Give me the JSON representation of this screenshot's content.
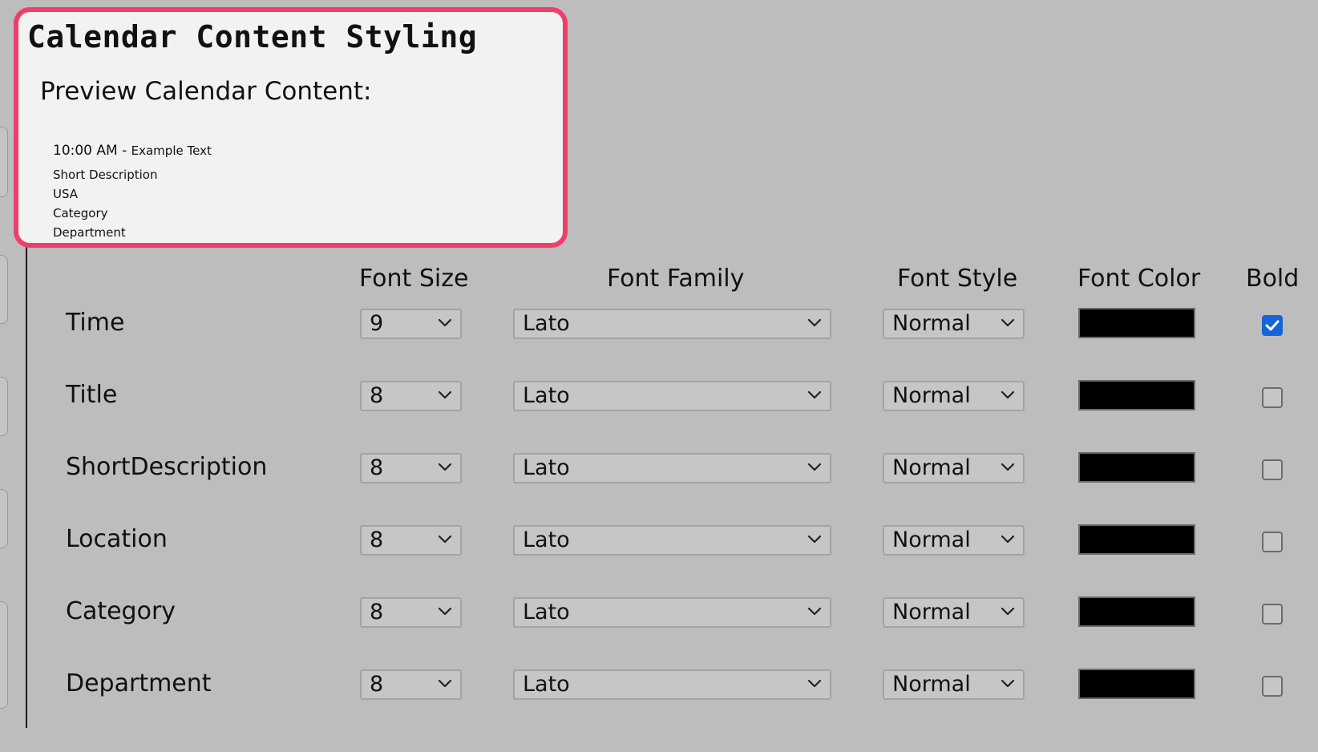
{
  "page_title": "Calendar Content Styling",
  "preview": {
    "label": "Preview Calendar Content:",
    "time": "10:00 AM - ",
    "title": "Example Text",
    "short_description": "Short Description",
    "location": "USA",
    "category": "Category",
    "department": "Department"
  },
  "columns": {
    "font_size": "Font Size",
    "font_family": "Font Family",
    "font_style": "Font Style",
    "font_color": "Font Color",
    "bold": "Bold"
  },
  "rows": [
    {
      "label": "Time",
      "font_size": "9",
      "font_family": "Lato",
      "font_style": "Normal",
      "font_color": "#000000",
      "bold": true
    },
    {
      "label": "Title",
      "font_size": "8",
      "font_family": "Lato",
      "font_style": "Normal",
      "font_color": "#000000",
      "bold": false
    },
    {
      "label": "ShortDescription",
      "font_size": "8",
      "font_family": "Lato",
      "font_style": "Normal",
      "font_color": "#000000",
      "bold": false
    },
    {
      "label": "Location",
      "font_size": "8",
      "font_family": "Lato",
      "font_style": "Normal",
      "font_color": "#000000",
      "bold": false
    },
    {
      "label": "Category",
      "font_size": "8",
      "font_family": "Lato",
      "font_style": "Normal",
      "font_color": "#000000",
      "bold": false
    },
    {
      "label": "Department",
      "font_size": "8",
      "font_family": "Lato",
      "font_style": "Normal",
      "font_color": "#000000",
      "bold": false
    }
  ],
  "colors": {
    "highlight_border": "#ef3e6a",
    "background": "#bdbdbd",
    "checkbox_checked": "#1565d8"
  }
}
